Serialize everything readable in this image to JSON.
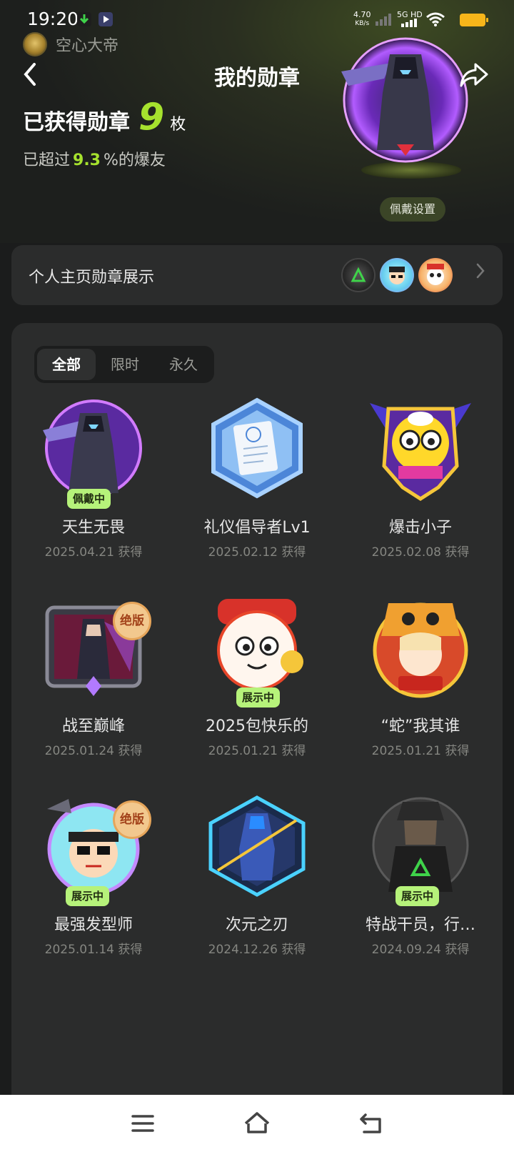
{
  "status_bar": {
    "time": "19:20",
    "net_speed_value": "4.70",
    "net_speed_unit": "KB/s",
    "network": "5G HD"
  },
  "user": {
    "name": "空心大帝"
  },
  "header": {
    "title": "我的勋章",
    "back_icon": "chevron-left-icon",
    "share_icon": "share-icon"
  },
  "summary": {
    "earned_label": "已获得勋章",
    "earned_count": "9",
    "earned_unit": "枚",
    "beat_prefix": "已超过",
    "beat_percent": "9.3",
    "beat_suffix": "%的爆友",
    "wear_button": "佩戴设置"
  },
  "display_row": {
    "label": "个人主页勋章展示",
    "chevron_icon": "chevron-right-icon"
  },
  "tabs": [
    {
      "label": "全部",
      "active": true
    },
    {
      "label": "限时",
      "active": false
    },
    {
      "label": "永久",
      "active": false
    }
  ],
  "badges": [
    {
      "name": "天生无畏",
      "date": "2025.04.21 获得",
      "tag": "佩戴中"
    },
    {
      "name": "礼仪倡导者Lv1",
      "date": "2025.02.12 获得",
      "tag": ""
    },
    {
      "name": "爆击小子",
      "date": "2025.02.08 获得",
      "tag": ""
    },
    {
      "name": "战至巅峰",
      "date": "2025.01.24 获得",
      "tag": "",
      "corner": "绝版"
    },
    {
      "name": "2025包快乐的",
      "date": "2025.01.21 获得",
      "tag": "展示中"
    },
    {
      "name": "“蛇”我其谁",
      "date": "2025.01.21 获得",
      "tag": ""
    },
    {
      "name": "最强发型师",
      "date": "2025.01.14 获得",
      "tag": "展示中",
      "corner": "绝版"
    },
    {
      "name": "次元之刃",
      "date": "2024.12.26 获得",
      "tag": ""
    },
    {
      "name": "特战干员，行…",
      "date": "2024.09.24 获得",
      "tag": "展示中"
    }
  ],
  "colors": {
    "accent": "#a6e22e",
    "tag_bg": "#b6f27a",
    "card_bg": "#2b2c2c",
    "page_bg": "#1b1c1c"
  },
  "nav": {
    "menu_icon": "menu-icon",
    "home_icon": "home-icon",
    "back_icon": "back-icon"
  }
}
